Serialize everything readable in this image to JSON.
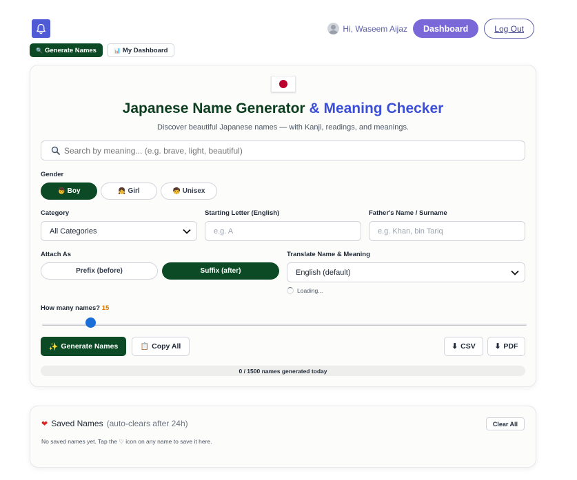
{
  "header": {
    "greeting": "Hi, Waseem Aijaz",
    "dashboard_label": "Dashboard",
    "logout_label": "Log Out"
  },
  "tabs": [
    {
      "icon": "🔍",
      "label": "Generate Names",
      "active": true
    },
    {
      "icon": "📊",
      "label": "My Dashboard",
      "active": false
    }
  ],
  "main": {
    "title_part1": "Japanese Name Generator",
    "title_part2": "& Meaning Checker",
    "subtitle": "Discover beautiful Japanese names — with Kanji, readings, and meanings.",
    "search_placeholder": "Search by meaning... (e.g. brave, light, beautiful)",
    "gender_label": "Gender",
    "gender_options": [
      {
        "icon": "👦",
        "label": "Boy",
        "selected": true
      },
      {
        "icon": "👧",
        "label": "Girl",
        "selected": false
      },
      {
        "icon": "🧒",
        "label": "Unisex",
        "selected": false
      }
    ],
    "category_label": "Category",
    "category_value": "All Categories",
    "starting_letter_label": "Starting Letter (English)",
    "starting_letter_placeholder": "e.g. A",
    "surname_label": "Father's Name / Surname",
    "surname_placeholder": "e.g. Khan, bin Tariq",
    "attach_label": "Attach As",
    "attach_options": [
      {
        "label": "Prefix (before)",
        "selected": false
      },
      {
        "label": "Suffix (after)",
        "selected": true
      }
    ],
    "translate_label": "Translate Name & Meaning",
    "translate_value": "English (default)",
    "loading_text": "Loading...",
    "count_label": "How many names?",
    "count_value": "15",
    "count_fraction": 0.1,
    "generate_label": "Generate Names",
    "copy_label": "Copy All",
    "csv_label": "CSV",
    "pdf_label": "PDF",
    "progress_text": "0 / 1500 names generated today"
  },
  "saved": {
    "title": "Saved Names",
    "subtitle": "(auto-clears after 24h)",
    "clear_label": "Clear All",
    "empty_text": "No saved names yet. Tap the ♡ icon on any name to save it here."
  },
  "colors": {
    "primary_green": "#0c4a25",
    "accent_blue": "#3b4fd8",
    "dashboard_purple": "#7a67d8",
    "slider_blue": "#1a6ed8"
  }
}
